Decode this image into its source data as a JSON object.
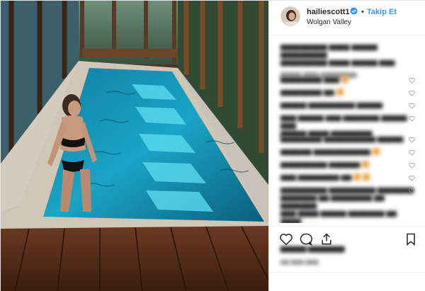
{
  "post": {
    "username": "hailiescott1",
    "follow_label": "Takip Et",
    "separator": "•",
    "location": "Wolgan Valley"
  },
  "icons": {
    "verified": "verified-badge-icon",
    "like": "heart-icon",
    "comment": "comment-bubble-icon",
    "share": "share-icon",
    "save": "bookmark-icon"
  },
  "colors": {
    "link_blue": "#3897f0",
    "text_dark": "#262626",
    "pool_water": "#2bb7d6"
  }
}
